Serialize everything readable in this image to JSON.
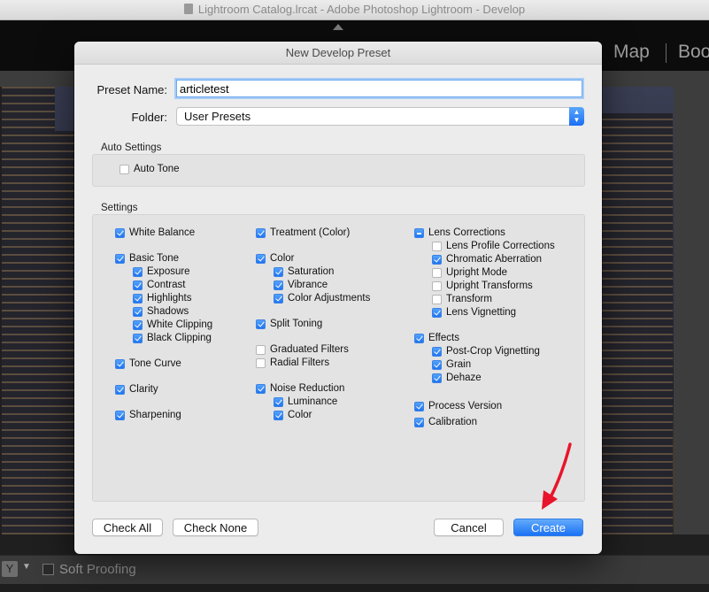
{
  "window": {
    "title": "Lightroom Catalog.lrcat - Adobe Photoshop Lightroom - Develop"
  },
  "modules": [
    "Map",
    "Boo"
  ],
  "bottom_toolbar": {
    "view_letter": "Y",
    "soft_proofing_label": "Soft Proofing",
    "soft_proofing_checked": false
  },
  "dialog": {
    "title": "New Develop Preset",
    "preset_name_label": "Preset Name:",
    "preset_name_value": "articletest",
    "folder_label": "Folder:",
    "folder_value": "User Presets",
    "auto_settings_label": "Auto Settings",
    "auto_tone": {
      "label": "Auto Tone",
      "checked": false
    },
    "settings_label": "Settings",
    "col1": [
      {
        "label": "White Balance",
        "state": "on"
      },
      {
        "label": "Basic Tone",
        "state": "on"
      },
      {
        "label": "Exposure",
        "state": "on",
        "indent": true
      },
      {
        "label": "Contrast",
        "state": "on",
        "indent": true
      },
      {
        "label": "Highlights",
        "state": "on",
        "indent": true
      },
      {
        "label": "Shadows",
        "state": "on",
        "indent": true
      },
      {
        "label": "White Clipping",
        "state": "on",
        "indent": true
      },
      {
        "label": "Black Clipping",
        "state": "on",
        "indent": true
      },
      {
        "label": "Tone Curve",
        "state": "on"
      },
      {
        "label": "Clarity",
        "state": "on"
      },
      {
        "label": "Sharpening",
        "state": "on"
      }
    ],
    "col2": [
      {
        "label": "Treatment (Color)",
        "state": "on"
      },
      {
        "label": "Color",
        "state": "on"
      },
      {
        "label": "Saturation",
        "state": "on",
        "indent": true
      },
      {
        "label": "Vibrance",
        "state": "on",
        "indent": true
      },
      {
        "label": "Color Adjustments",
        "state": "on",
        "indent": true
      },
      {
        "label": "Split Toning",
        "state": "on"
      },
      {
        "label": "Graduated Filters",
        "state": "off"
      },
      {
        "label": "Radial Filters",
        "state": "off"
      },
      {
        "label": "Noise Reduction",
        "state": "on"
      },
      {
        "label": "Luminance",
        "state": "on",
        "indent": true
      },
      {
        "label": "Color",
        "state": "on",
        "indent": true
      }
    ],
    "col3": [
      {
        "label": "Lens Corrections",
        "state": "mixed"
      },
      {
        "label": "Lens Profile Corrections",
        "state": "off",
        "indent": true
      },
      {
        "label": "Chromatic Aberration",
        "state": "on",
        "indent": true
      },
      {
        "label": "Upright Mode",
        "state": "off",
        "indent": true
      },
      {
        "label": "Upright Transforms",
        "state": "off",
        "indent": true
      },
      {
        "label": "Transform",
        "state": "off",
        "indent": true
      },
      {
        "label": "Lens Vignetting",
        "state": "on",
        "indent": true
      },
      {
        "label": "Effects",
        "state": "on"
      },
      {
        "label": "Post-Crop Vignetting",
        "state": "on",
        "indent": true
      },
      {
        "label": "Grain",
        "state": "on",
        "indent": true
      },
      {
        "label": "Dehaze",
        "state": "on",
        "indent": true
      },
      {
        "label": "Process Version",
        "state": "on"
      },
      {
        "label": "Calibration",
        "state": "on"
      }
    ],
    "buttons": {
      "check_all": "Check All",
      "check_none": "Check None",
      "cancel": "Cancel",
      "create": "Create"
    }
  },
  "colors": {
    "accent": "#1f74f1",
    "annotation_arrow": "#e8142b"
  }
}
